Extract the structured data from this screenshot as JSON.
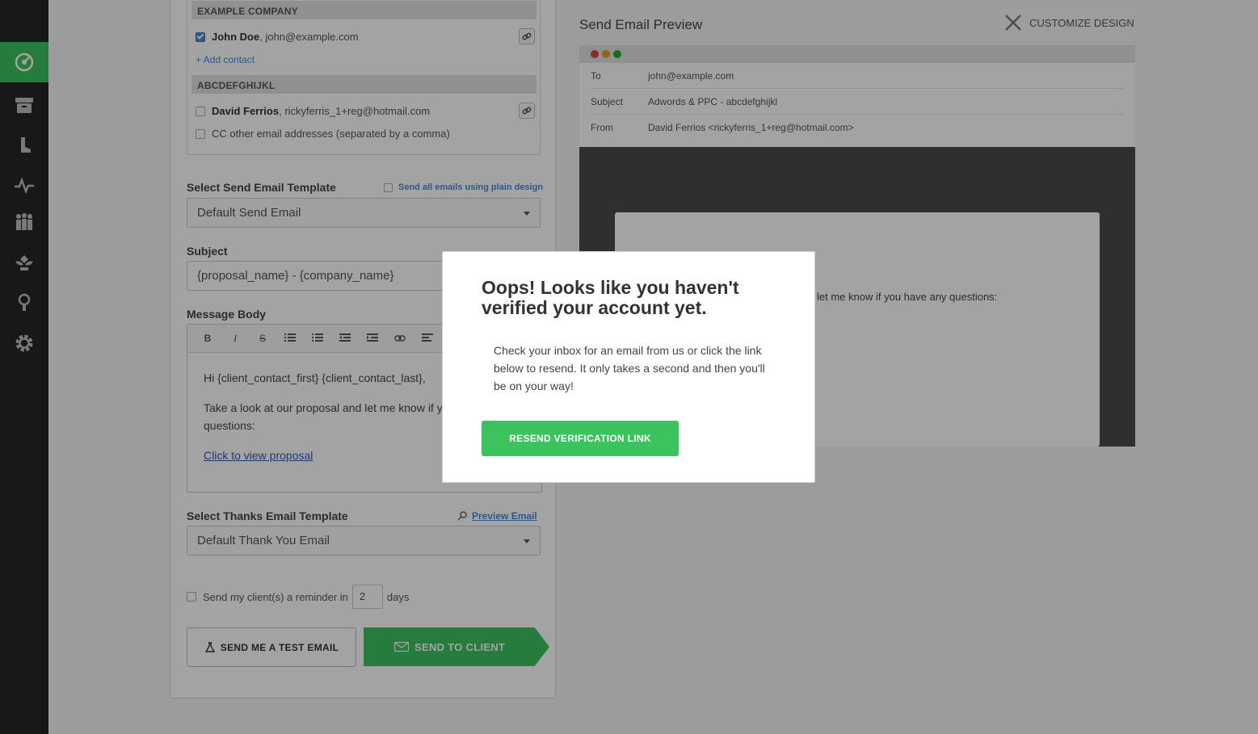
{
  "recipients": {
    "groups": [
      {
        "name": "EXAMPLE COMPANY",
        "contacts": [
          {
            "name": "John Doe",
            "email": ", john@example.com",
            "checked": true
          }
        ],
        "add_contact_label": "+ Add contact"
      },
      {
        "name": "ABCDEFGHIJKL",
        "contacts": [
          {
            "name": "David Ferrios",
            "email": ", rickyferris_1+reg@hotmail.com",
            "checked": false
          }
        ],
        "cc_label": "CC other email addresses (separated by a comma)"
      }
    ]
  },
  "send_template": {
    "label": "Select Send Email Template",
    "plain_design_label": "Send all emails using plain design",
    "selected": "Default Send Email"
  },
  "subject": {
    "label": "Subject",
    "value": "{proposal_name} - {company_name}"
  },
  "message": {
    "label": "Message Body",
    "toolbar": [
      "B",
      "I",
      "S"
    ],
    "greeting": "Hi {client_contact_first} {client_contact_last},",
    "body": "Take a look at our proposal and let me know if you have any questions:",
    "link": "Click to view proposal"
  },
  "thanks_template": {
    "label": "Select Thanks Email Template",
    "preview_label": "Preview Email",
    "selected": "Default Thank You Email"
  },
  "reminder": {
    "before": "Send my client(s) a reminder in",
    "days": "2",
    "after": "days"
  },
  "buttons": {
    "test": "SEND ME A TEST EMAIL",
    "send": "SEND TO CLIENT"
  },
  "preview": {
    "title": "Send Email Preview",
    "customize_label": "CUSTOMIZE DESIGN",
    "rows": [
      {
        "key": "To",
        "value": "john@example.com"
      },
      {
        "key": "Subject",
        "value": "Adwords & PPC - abcdefghijkl"
      },
      {
        "key": "From",
        "value": "David Ferrios <rickyferris_1+reg@hotmail.com>"
      }
    ],
    "body_snippet": "let me know if you have any questions:"
  },
  "modal": {
    "title": "Oops! Looks like you haven't verified your account yet.",
    "body": "Check your inbox for an email from us or click the link below to resend. It only takes a second and then you'll be on your way!",
    "button": "RESEND VERIFICATION LINK"
  },
  "colors": {
    "accent": "#3cc35e",
    "sidebar": "#262626",
    "link": "#4a8ad8"
  },
  "sidebar_icons": [
    "dashboard-icon",
    "archive-icon",
    "tools-icon",
    "activity-icon",
    "team-icon",
    "plant-icon",
    "lightbulb-icon",
    "settings-icon"
  ]
}
